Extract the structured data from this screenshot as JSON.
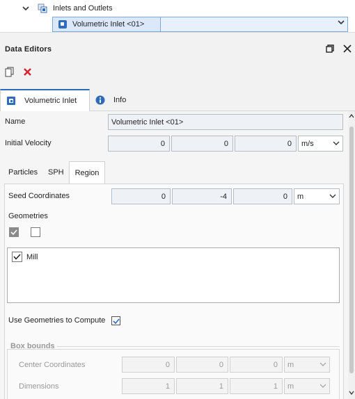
{
  "tree": {
    "parent_label": "Inlets and Outlets",
    "selected_label": "Volumetric Inlet <01>"
  },
  "data_editors": {
    "title": "Data Editors",
    "tabs": [
      {
        "label": "Volumetric Inlet",
        "icon": "volumetric-inlet-icon"
      },
      {
        "label": "Info",
        "icon": "info-icon"
      }
    ]
  },
  "form": {
    "name_label": "Name",
    "name_value": "Volumetric Inlet <01>",
    "velocity_label": "Initial Velocity",
    "velocity_values": [
      "0",
      "0",
      "0"
    ],
    "velocity_unit": "m/s"
  },
  "subtabs": [
    "Particles",
    "SPH",
    "Region"
  ],
  "region": {
    "seed_label": "Seed Coordinates",
    "seed_values": [
      "0",
      "-4",
      "0"
    ],
    "seed_unit": "m",
    "geometries_label": "Geometries",
    "geometries": [
      {
        "label": "Mill",
        "checked": true
      }
    ],
    "use_geometries_label": "Use Geometries to Compute",
    "box_bounds_label": "Box bounds",
    "center_label": "Center Coordinates",
    "center_values": [
      "0",
      "0",
      "0"
    ],
    "center_unit": "m",
    "dimensions_label": "Dimensions",
    "dimensions_values": [
      "1",
      "1",
      "1"
    ],
    "dimensions_unit": "m"
  },
  "colors": {
    "accent": "#2f6bbd",
    "close_red": "#d0282e"
  }
}
